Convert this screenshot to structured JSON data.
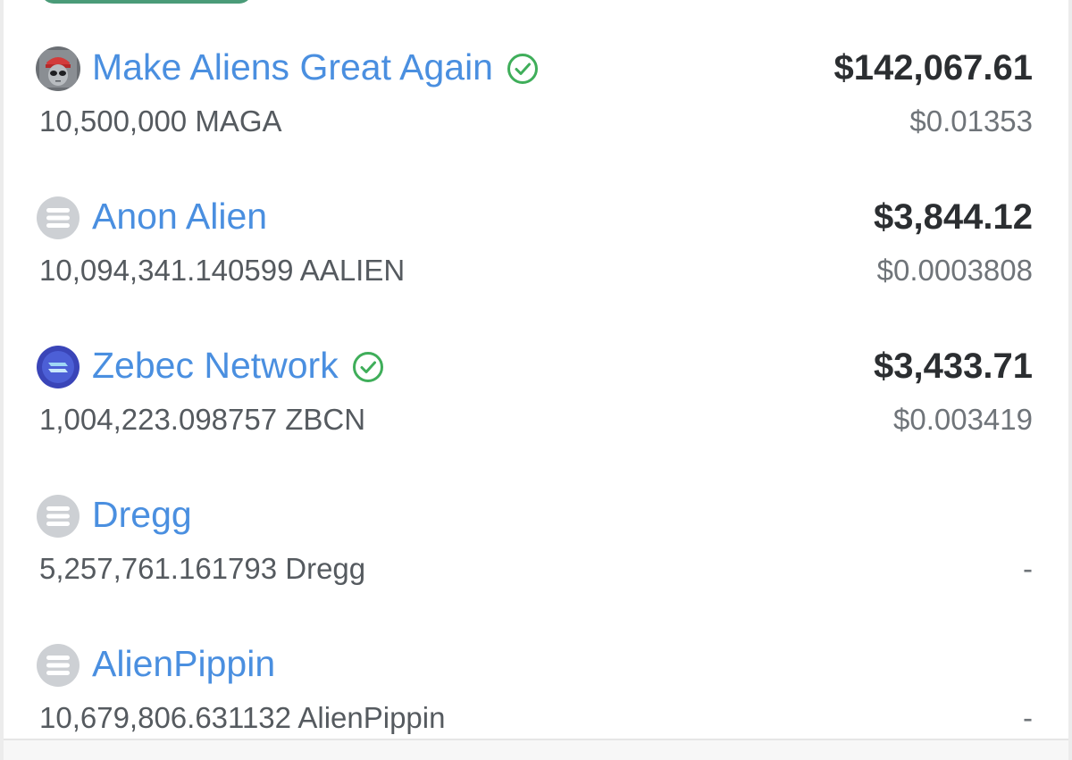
{
  "colors": {
    "link": "#4a8fe0",
    "verified": "#3fae5a",
    "value_text": "#2b2e31",
    "secondary_text": "#555a5f"
  },
  "tokens": [
    {
      "name": "Make Aliens Great Again",
      "verified": true,
      "icon": "alien-maga-avatar-icon",
      "amount": "10,500,000 MAGA",
      "value": "$142,067.61",
      "price": "$0.01353"
    },
    {
      "name": "Anon Alien",
      "verified": false,
      "icon": "generic-token-icon",
      "amount": "10,094,341.140599 AALIEN",
      "value": "$3,844.12",
      "price": "$0.0003808"
    },
    {
      "name": "Zebec Network",
      "verified": true,
      "icon": "zebec-logo-icon",
      "amount": "1,004,223.098757 ZBCN",
      "value": "$3,433.71",
      "price": "$0.003419"
    },
    {
      "name": "Dregg",
      "verified": false,
      "icon": "generic-token-icon",
      "amount": "5,257,761.161793 Dregg",
      "value": "",
      "price": "-"
    },
    {
      "name": "AlienPippin",
      "verified": false,
      "icon": "generic-token-icon",
      "amount": "10,679,806.631132 AlienPippin",
      "value": "",
      "price": "-"
    }
  ]
}
